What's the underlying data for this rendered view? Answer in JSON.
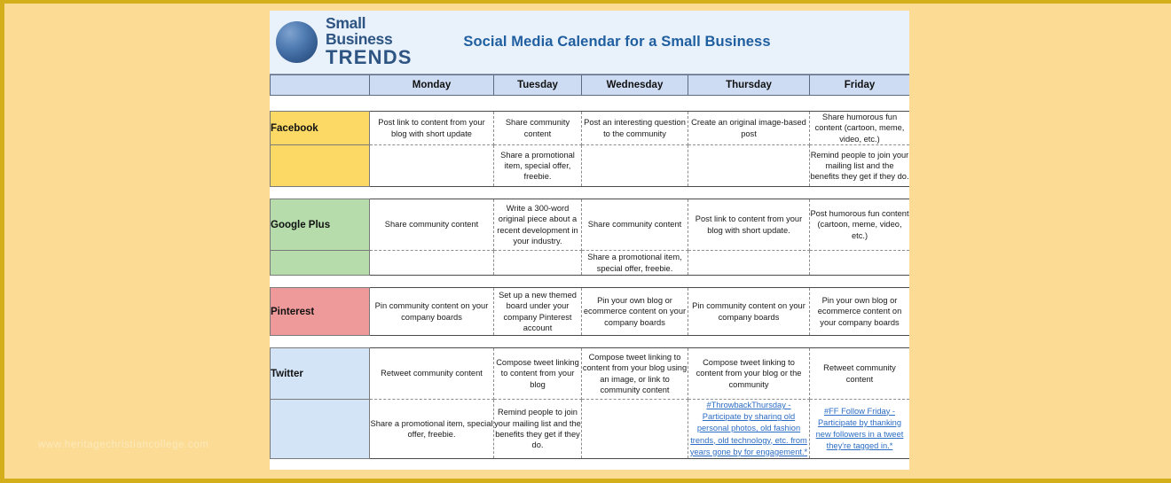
{
  "watermark": "www.heritagechristiancollege.com",
  "header": {
    "logo_line1": "Small Business",
    "logo_line2": "TRENDS",
    "title": "Social Media Calendar for a Small Business"
  },
  "columns": {
    "corner": "",
    "days": [
      "Monday",
      "Tuesday",
      "Wednesday",
      "Thursday",
      "Friday"
    ]
  },
  "colors": {
    "facebook": "#fcd965",
    "google_plus": "#b6dcab",
    "pinterest": "#ef9a9a",
    "twitter": "#d4e4f7",
    "header_band": "#e9f1fb",
    "day_header": "#cddcf3",
    "title_blue": "#1f5fa0",
    "link_blue": "#2b6cc4",
    "frame_gold": "#fcdb94",
    "frame_gold_edge": "#d5ae1c"
  },
  "rows": [
    {
      "label": "Facebook",
      "lines": [
        {
          "cells": [
            "Post link to content from your blog with short update",
            "Share community content",
            "Post an interesting question to the community",
            "Create an original image-based post",
            "Share humorous fun content (cartoon, meme, video, etc.)"
          ]
        },
        {
          "cells": [
            "",
            "Share a promotional item, special offer, freebie.",
            "",
            "",
            "Remind people to join your mailing list and the benefits they get if they do."
          ]
        }
      ]
    },
    {
      "label": "Google Plus",
      "lines": [
        {
          "cells": [
            "Share community content",
            "Write a 300-word original piece about a recent development in your industry.",
            "Share community content",
            "Post link to content from your blog with short update.",
            "Post humorous fun content (cartoon, meme, video, etc.)"
          ]
        },
        {
          "cells": [
            "",
            "",
            "Share a promotional item, special offer, freebie.",
            "",
            ""
          ]
        }
      ]
    },
    {
      "label": "Pinterest",
      "lines": [
        {
          "cells": [
            "Pin community content on your company boards",
            "Set up a new themed board under your company Pinterest account",
            "Pin your own blog or ecommerce content on your company boards",
            "Pin community content on your company boards",
            "Pin your own blog or ecommerce content on your company boards"
          ]
        }
      ]
    },
    {
      "label": "Twitter",
      "lines": [
        {
          "cells": [
            "Retweet community content",
            "Compose tweet linking to content from your blog",
            "Compose tweet linking to content from your blog using an image, or link to community content",
            "Compose tweet linking to content from your blog or the community",
            "Retweet community content"
          ]
        },
        {
          "cells": [
            "Share a promotional item, special offer, freebie.",
            "Remind people to join your mailing list and the benefits they get if they do.",
            "",
            "#ThrowbackThursday - Participate by sharing old personal photos, old fashion trends, old technology, etc. from years gone by for engagement.*",
            "#FF Follow Friday - Participate by thanking new followers in a tweet they're tagged in.*"
          ],
          "links": [
            false,
            false,
            false,
            true,
            true
          ]
        }
      ]
    }
  ]
}
